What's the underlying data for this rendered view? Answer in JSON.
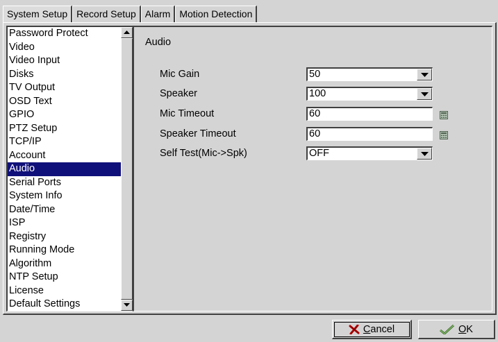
{
  "tabs": [
    {
      "label": "System Setup",
      "active": true
    },
    {
      "label": "Record Setup",
      "active": false
    },
    {
      "label": "Alarm",
      "active": false
    },
    {
      "label": "Motion Detection",
      "active": false
    }
  ],
  "sidebar": {
    "selected": "Audio",
    "items": [
      "Password Protect",
      "Video",
      "Video Input",
      "Disks",
      "TV Output",
      "OSD Text",
      "GPIO",
      "PTZ Setup",
      "TCP/IP",
      "Account",
      "Audio",
      "Serial Ports",
      "System Info",
      "Date/Time",
      "ISP",
      "Registry",
      "Running Mode",
      "Algorithm",
      "NTP Setup",
      "License",
      "Default Settings"
    ]
  },
  "panel": {
    "title": "Audio",
    "mic_gain": {
      "label": "Mic Gain",
      "value": "50"
    },
    "speaker": {
      "label": "Speaker",
      "value": "100"
    },
    "mic_timeout": {
      "label": "Mic Timeout",
      "value": "60"
    },
    "speaker_timeout": {
      "label": "Speaker Timeout",
      "value": "60"
    },
    "self_test": {
      "label": "Self Test(Mic->Spk)",
      "value": "OFF"
    }
  },
  "buttons": {
    "cancel_prefix": "",
    "cancel_underline": "C",
    "cancel_rest": "ancel",
    "ok_underline": "O",
    "ok_rest": "K"
  },
  "icons": {
    "cancel": "x-mark-icon",
    "ok": "check-mark-icon",
    "calculator": "calculator-icon"
  },
  "colors": {
    "selection": "#10107a",
    "face": "#d4d4d4"
  }
}
